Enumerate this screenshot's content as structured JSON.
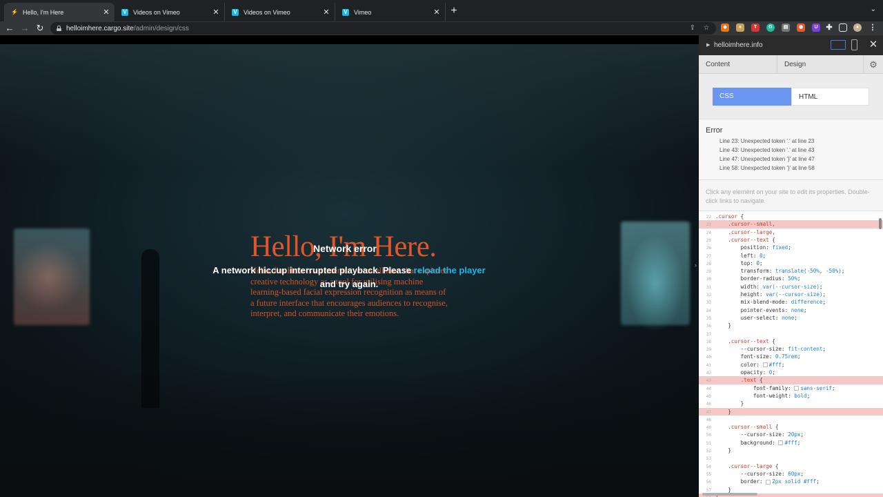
{
  "browser": {
    "tabs": [
      {
        "title": "Hello, I'm Here",
        "favicon": "cargo-icon",
        "active": true
      },
      {
        "title": "Videos on Vimeo",
        "favicon": "vimeo-icon",
        "active": false
      },
      {
        "title": "Videos on Vimeo",
        "favicon": "vimeo-icon",
        "active": false
      },
      {
        "title": "Vimeo",
        "favicon": "vimeo-icon",
        "active": false
      }
    ],
    "new_tab_label": "+",
    "tab_close": "✕",
    "url_host": "helloimhere.cargo.site",
    "url_path": "/admin/design/css",
    "fav_v": "V"
  },
  "site": {
    "title": "Hello, I'm Here.",
    "body": "Hello, I'm Here is an interactive installation that explores creative technology as a tool for utilising machine learning-based facial expression recognition as means of a future interface that encourages audiences to recognise, interpret, and communicate their emotions.",
    "error_title": "Network error",
    "error_msg_before": "A network hiccup interrupted playback. Please ",
    "error_msg_link": "reload the player",
    "error_msg_after": " and try again."
  },
  "panel": {
    "site_name": "helloimhere.info",
    "tabs": {
      "content": "Content",
      "design": "Design"
    },
    "toggle": {
      "css": "CSS",
      "html": "HTML"
    },
    "error": {
      "title": "Error",
      "lines": [
        "Line 23: Unexpected token '.' at line 23",
        "Line 43: Unexpected token '.' at line 43",
        "Line 47: Unexpected token '}' at line 47",
        "Line 58: Unexpected token '}' at line 58"
      ]
    },
    "hint": "Click any element on your site to edit its properties. Double-click links to navigate."
  },
  "code": [
    {
      "n": "22",
      "err": false,
      "text": ".cursor {"
    },
    {
      "n": "23",
      "err": true,
      "text": "    .cursor--small,"
    },
    {
      "n": "24",
      "err": false,
      "text": "    .cursor--large,"
    },
    {
      "n": "25",
      "err": false,
      "text": "    .cursor--text {"
    },
    {
      "n": "26",
      "err": false,
      "text": "        position: fixed;"
    },
    {
      "n": "27",
      "err": false,
      "text": "        left: 0;"
    },
    {
      "n": "28",
      "err": false,
      "text": "        top: 0;"
    },
    {
      "n": "29",
      "err": false,
      "text": "        transform: translate(-50%, -50%);"
    },
    {
      "n": "30",
      "err": false,
      "text": "        border-radius: 50%;"
    },
    {
      "n": "31",
      "err": false,
      "text": "        width: var(--cursor-size);"
    },
    {
      "n": "32",
      "err": false,
      "text": "        height: var(--cursor-size);"
    },
    {
      "n": "33",
      "err": false,
      "text": "        mix-blend-mode: difference;"
    },
    {
      "n": "34",
      "err": false,
      "text": "        pointer-events: none;"
    },
    {
      "n": "35",
      "err": false,
      "text": "        user-select: none;"
    },
    {
      "n": "36",
      "err": false,
      "text": "    }"
    },
    {
      "n": "37",
      "err": false,
      "text": ""
    },
    {
      "n": "38",
      "err": false,
      "text": "    .cursor--text {"
    },
    {
      "n": "39",
      "err": false,
      "text": "        --cursor-size: fit-content;"
    },
    {
      "n": "40",
      "err": false,
      "text": "        font-size: 0.75rem;"
    },
    {
      "n": "41",
      "err": false,
      "text": "        color: #fff;"
    },
    {
      "n": "42",
      "err": false,
      "text": "        opacity: 0;"
    },
    {
      "n": "43",
      "err": true,
      "text": "        .text {"
    },
    {
      "n": "44",
      "err": false,
      "text": "            font-family: sans-serif;"
    },
    {
      "n": "45",
      "err": false,
      "text": "            font-weight: bold;"
    },
    {
      "n": "46",
      "err": false,
      "text": "        }"
    },
    {
      "n": "47",
      "err": true,
      "text": "    }"
    },
    {
      "n": "48",
      "err": false,
      "text": ""
    },
    {
      "n": "49",
      "err": false,
      "text": "    .cursor--small {"
    },
    {
      "n": "50",
      "err": false,
      "text": "        --cursor-size: 20px;"
    },
    {
      "n": "51",
      "err": false,
      "text": "        background: #fff;"
    },
    {
      "n": "52",
      "err": false,
      "text": "    }"
    },
    {
      "n": "53",
      "err": false,
      "text": ""
    },
    {
      "n": "54",
      "err": false,
      "text": "    .cursor--large {"
    },
    {
      "n": "55",
      "err": false,
      "text": "        --cursor-size: 60px;"
    },
    {
      "n": "56",
      "err": false,
      "text": "        border: 2px solid #fff;"
    },
    {
      "n": "57",
      "err": false,
      "text": "    }"
    },
    {
      "n": "58",
      "err": true,
      "text": "}"
    }
  ],
  "colors": {
    "accent": "#e0562a",
    "vimeo": "#1ab7ea",
    "css_toggle": "#6a95f0",
    "error_line": "#f6c7c7"
  }
}
